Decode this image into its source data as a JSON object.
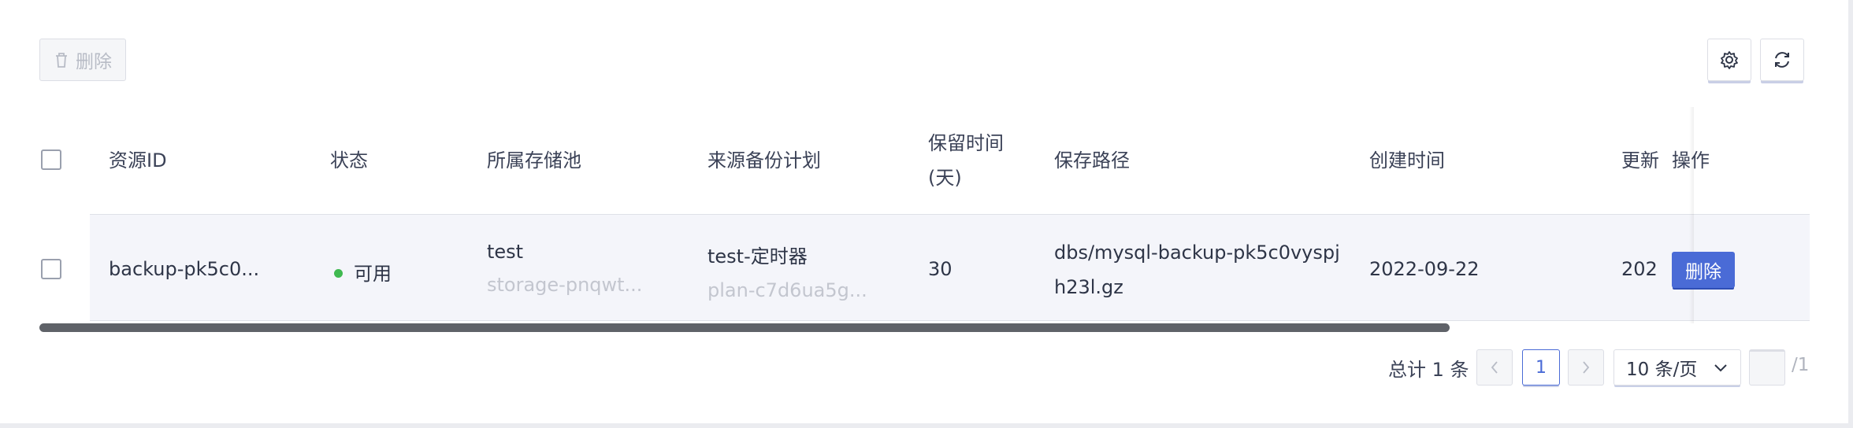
{
  "toolbar": {
    "delete_label": "删除",
    "settings_icon": "gear-icon",
    "refresh_icon": "refresh-icon"
  },
  "table": {
    "columns": [
      {
        "key": "id",
        "label": "资源ID"
      },
      {
        "key": "status",
        "label": "状态"
      },
      {
        "key": "pool",
        "label": "所属存储池"
      },
      {
        "key": "plan",
        "label": "来源备份计划"
      },
      {
        "key": "retention",
        "label": "保留时间\n(天)"
      },
      {
        "key": "path",
        "label": "保存路径"
      },
      {
        "key": "created",
        "label": "创建时间"
      },
      {
        "key": "updated",
        "label": "更新"
      },
      {
        "key": "ops",
        "label": "操作"
      }
    ],
    "rows": [
      {
        "id": "backup-pk5c0...",
        "status": "可用",
        "status_color": "#3fb950",
        "pool_name": "test",
        "pool_id": "storage-pnqwt...",
        "plan_name": "test-定时器",
        "plan_id": "plan-c7d6ua5g...",
        "retention": "30",
        "path": "dbs/mysql-backup-pk5c0vyspj\nh23l.gz",
        "created": "2022-09-22",
        "updated": "202",
        "action": "删除"
      }
    ]
  },
  "pagination": {
    "total_text": "总计 1 条",
    "current_page": "1",
    "page_size": "10 条/页",
    "total_pages": "/1"
  },
  "colors": {
    "accent": "#4a6bd6",
    "status_ok": "#3fb950",
    "row_bg": "#f4f5fa"
  }
}
